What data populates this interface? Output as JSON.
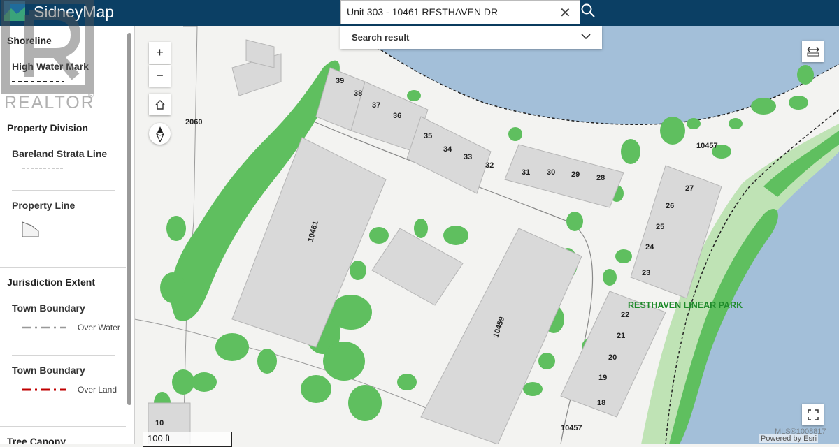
{
  "header": {
    "title": "SidneyMap"
  },
  "search": {
    "value": "Unit 303 - 10461 RESTHAVEN DR",
    "result_label": "Search result"
  },
  "sidebar": {
    "shoreline": {
      "heading": "Shoreline",
      "item": "High Water Mark"
    },
    "property_division": {
      "heading": "Property Division",
      "strata": "Bareland Strata Line",
      "property_line": "Property Line"
    },
    "jurisdiction": {
      "heading": "Jurisdiction Extent",
      "boundary1": {
        "label": "Town Boundary",
        "sub": "Over Water"
      },
      "boundary2": {
        "label": "Town Boundary",
        "sub": "Over Land"
      }
    },
    "tree_canopy": {
      "heading": "Tree Canopy"
    }
  },
  "map": {
    "lot_numbers": [
      "39",
      "38",
      "37",
      "36",
      "35",
      "34",
      "33",
      "32",
      "31",
      "30",
      "29",
      "28",
      "27",
      "26",
      "25",
      "24",
      "23",
      "22",
      "21",
      "20",
      "19",
      "18",
      "10"
    ],
    "addresses": [
      "10461",
      "10459",
      "10457",
      "10457",
      "2060"
    ],
    "park_label": "RESTHAVEN LINEAR PARK",
    "scale_label": "100 ft",
    "attribution": "Powered by Esri",
    "watermark_id": "MLS®1008817",
    "colors": {
      "water": "#a3bfd9",
      "land": "#f3f3f1",
      "tree": "#5fbf5f",
      "park": "#bfe3b5",
      "building": "#d9d9d9",
      "header": "#0b3f64"
    }
  },
  "watermark": {
    "text": "REALTOR"
  }
}
